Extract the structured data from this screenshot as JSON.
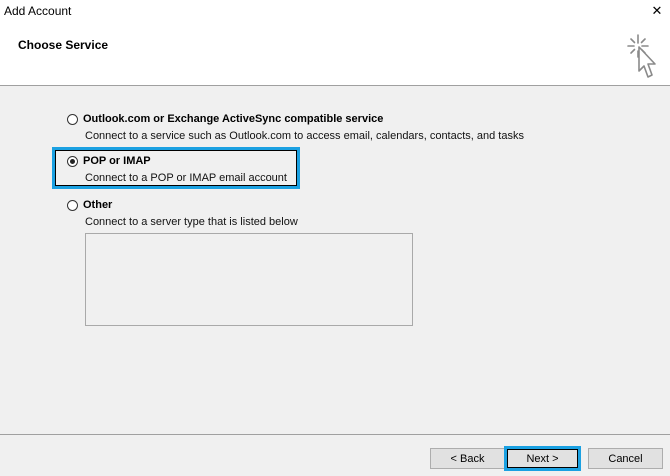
{
  "window": {
    "title": "Add Account",
    "close_glyph": "✕"
  },
  "header": {
    "page_title": "Choose Service",
    "icon": "wizard-cursor-sparkle-icon"
  },
  "options": [
    {
      "label": "Outlook.com or Exchange ActiveSync compatible service",
      "description": "Connect to a service such as Outlook.com to access email, calendars, contacts, and tasks",
      "selected": false
    },
    {
      "label": "POP or IMAP",
      "description": "Connect to a POP or IMAP email account",
      "selected": true
    },
    {
      "label": "Other",
      "description": "Connect to a server type that is listed below",
      "selected": false
    }
  ],
  "buttons": {
    "back": "< Back",
    "next": "Next >",
    "cancel": "Cancel"
  },
  "colors": {
    "highlight": "#1ba1e2",
    "dialog_bg": "#f0f0f0",
    "button_bg": "#e1e1e1"
  }
}
